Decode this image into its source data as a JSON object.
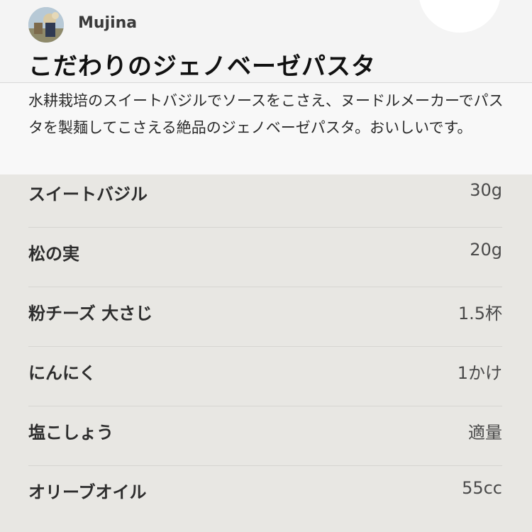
{
  "recipe": {
    "author": "Mujina",
    "title": "こだわりのジェノベーゼパスタ",
    "description": "水耕栽培のスイートバジルでソースをこさえ、ヌードルメーカーでパスタを製麺してこさえる絶品のジェノベーゼパスタ。おいしいです。"
  },
  "ingredients": [
    {
      "name": "スイートバジル",
      "quantity": "30g"
    },
    {
      "name": "松の実",
      "quantity": "20g"
    },
    {
      "name": "粉チーズ 大さじ",
      "quantity": "1.5杯"
    },
    {
      "name": "にんにく",
      "quantity": "1かけ"
    },
    {
      "name": "塩こしょう",
      "quantity": "適量"
    },
    {
      "name": "オリーブオイル",
      "quantity": "55cc"
    }
  ]
}
